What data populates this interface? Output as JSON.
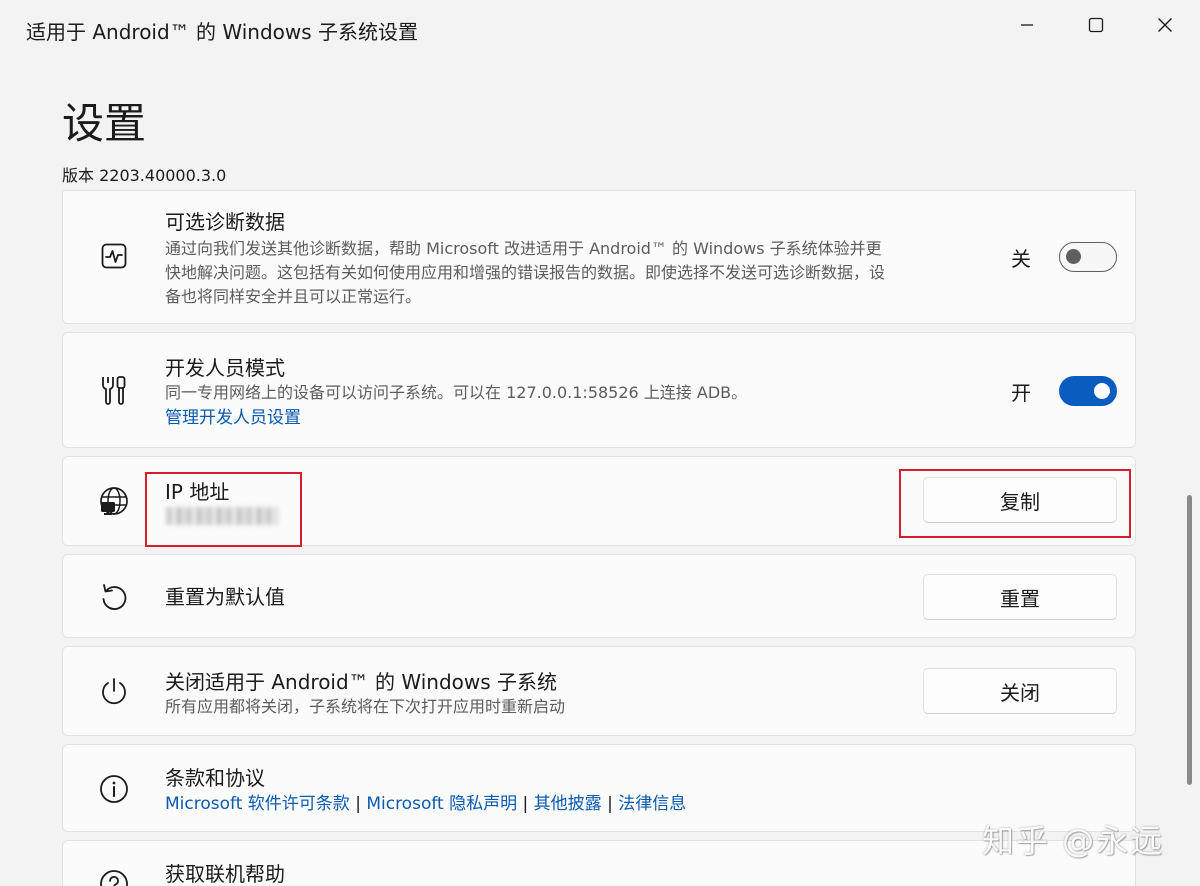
{
  "window": {
    "title": "适用于 Android™ 的 Windows 子系统设置",
    "controls": {
      "minimize": "minimize-icon",
      "maximize": "maximize-icon",
      "close": "close-icon"
    }
  },
  "page": {
    "title": "设置",
    "version": "版本 2203.40000.3.0"
  },
  "settings": {
    "diagnostics": {
      "icon": "activity-monitor-icon",
      "title": "可选诊断数据",
      "description": "通过向我们发送其他诊断数据，帮助 Microsoft 改进适用于 Android™ 的 Windows 子系统体验并更快地解决问题。这包括有关如何使用应用和增强的错误报告的数据。即使选择不发送可选诊断数据，设备也将同样安全并且可以正常运行。",
      "toggle_label": "关",
      "toggle_state": "off"
    },
    "developer_mode": {
      "icon": "tools-icon",
      "title": "开发人员模式",
      "description": "同一专用网络上的设备可以访问子系统。可以在 127.0.0.1:58526 上连接 ADB。",
      "link": "管理开发人员设置",
      "toggle_label": "开",
      "toggle_state": "on"
    },
    "ip_address": {
      "icon": "globe-network-icon",
      "title": "IP 地址",
      "button": "复制"
    },
    "reset": {
      "icon": "reset-icon",
      "title": "重置为默认值",
      "button": "重置"
    },
    "shutdown": {
      "icon": "power-icon",
      "title": "关闭适用于 Android™ 的 Windows 子系统",
      "description": "所有应用都将关闭，子系统将在下次打开应用时重新启动",
      "button": "关闭"
    },
    "terms": {
      "icon": "info-icon",
      "title": "条款和协议",
      "links": [
        "Microsoft 软件许可条款",
        "Microsoft 隐私声明",
        "其他披露",
        "法律信息"
      ],
      "separator": "|"
    },
    "help": {
      "icon": "help-icon",
      "title": "获取联机帮助"
    }
  },
  "colors": {
    "accent": "#0b5cbf",
    "link": "#0a5ab0",
    "highlight_box": "#d3202a"
  },
  "watermark": "知乎 @永远"
}
